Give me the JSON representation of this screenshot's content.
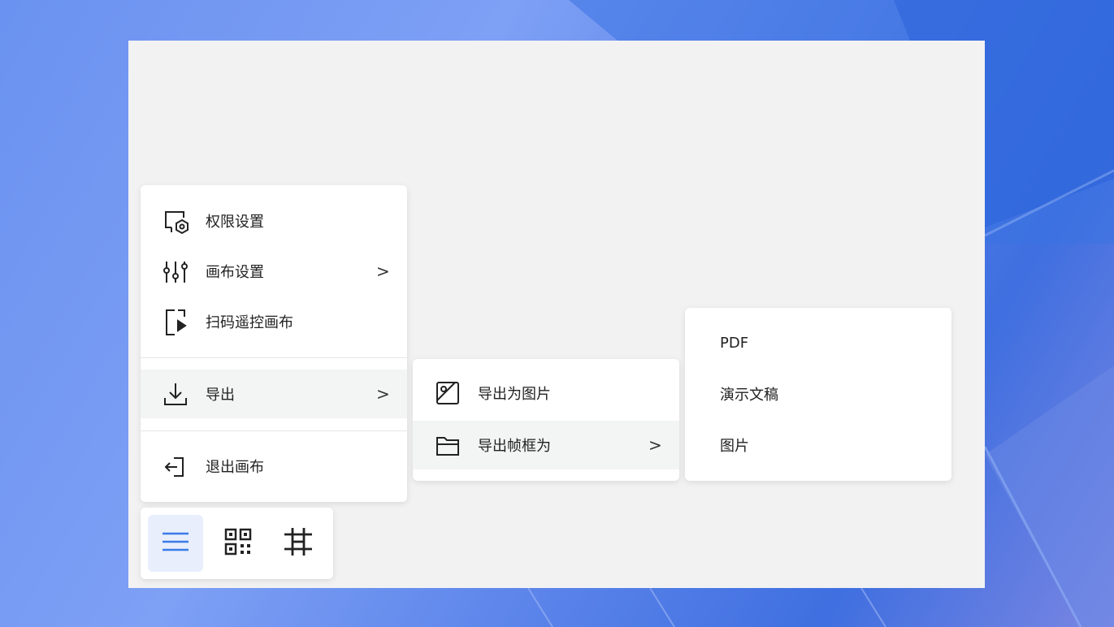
{
  "main_menu": {
    "items": [
      {
        "label": "权限设置",
        "icon": "permission-icon"
      },
      {
        "label": "画布设置",
        "icon": "sliders-icon",
        "chevron": ">"
      },
      {
        "label": "扫码遥控画布",
        "icon": "scan-remote-icon"
      },
      {
        "label": "导出",
        "icon": "download-icon",
        "chevron": ">"
      },
      {
        "label": "退出画布",
        "icon": "exit-icon"
      }
    ]
  },
  "export_menu": {
    "items": [
      {
        "label": "导出为图片",
        "icon": "image-icon"
      },
      {
        "label": "导出帧框为",
        "icon": "folder-icon",
        "chevron": ">"
      }
    ]
  },
  "frame_menu": {
    "items": [
      {
        "label": "PDF"
      },
      {
        "label": "演示文稿"
      },
      {
        "label": "图片"
      }
    ]
  },
  "toolbar": {
    "buttons": [
      {
        "icon": "menu-icon",
        "active": true
      },
      {
        "icon": "qrcode-icon",
        "active": false
      },
      {
        "icon": "frame-icon",
        "active": false
      }
    ]
  },
  "colors": {
    "accent": "#3b7be8",
    "canvas_bg": "#f2f2f2",
    "highlight_bg": "#f3f4f4"
  }
}
